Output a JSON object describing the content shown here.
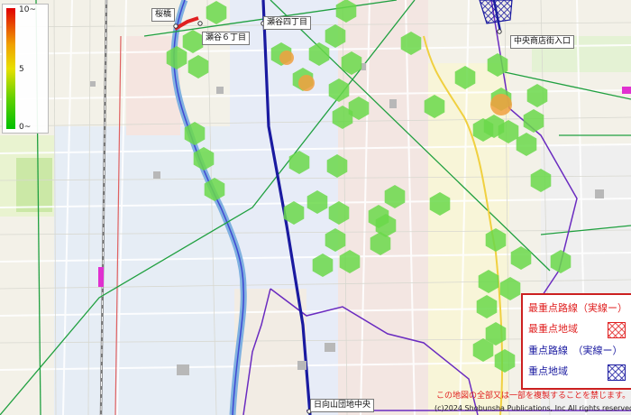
{
  "scale": {
    "max_label": "10~",
    "mid_label": "5",
    "min_label": "0~"
  },
  "places": {
    "sakurabashi": "桜橋",
    "seya6": "瀬谷６丁目",
    "seya4": "瀬谷四丁目",
    "chuo_shotengai": "中央商店街入口",
    "hinatayama": "日向山団地中央"
  },
  "legend": {
    "most_route": "最重点路線（実線ー）",
    "most_area": "最重点地域",
    "key_route": "重点路線　（実線ー）",
    "key_area": "重点地域"
  },
  "notice": "この地図の全部又は一部を複製することを禁じます。",
  "copyright": "(c)2024 Shobunsha Publications, Inc All rights reserved.",
  "colors": {
    "most_route": "#e02020",
    "key_route": "#1a1aa0",
    "hotspot_green": "#6ad84a",
    "hotspot_orange": "#f0a040"
  }
}
